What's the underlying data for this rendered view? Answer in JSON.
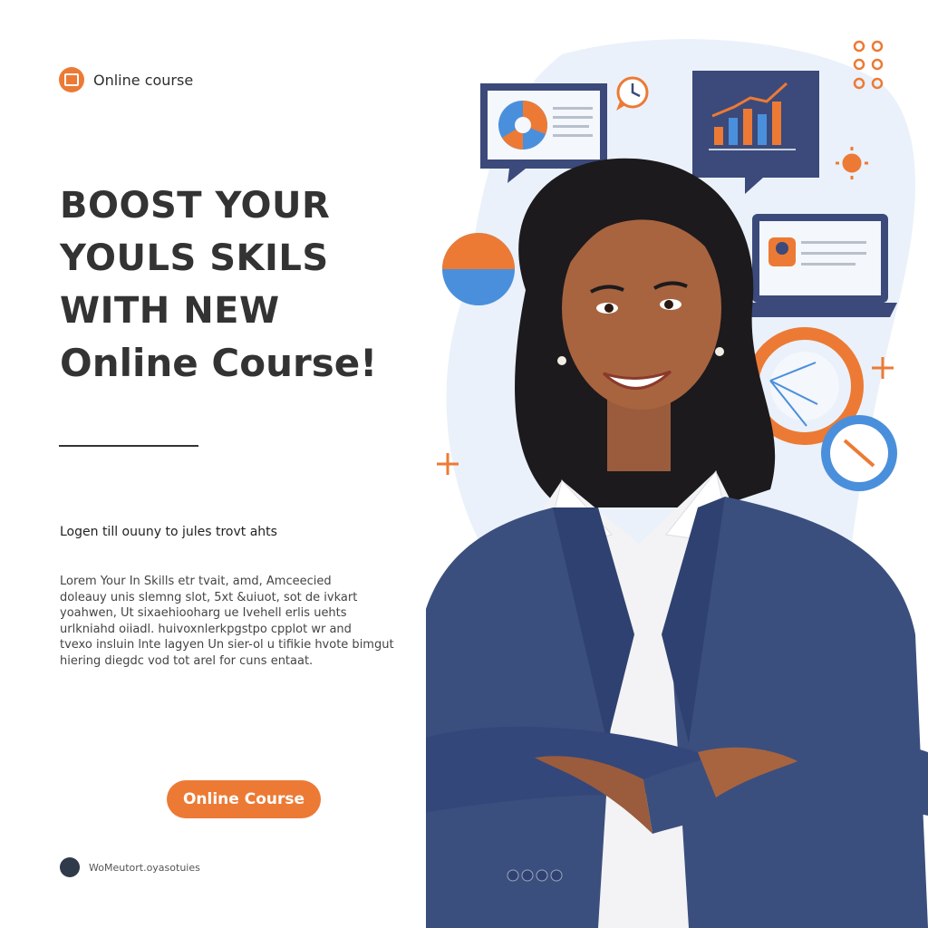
{
  "brand": {
    "label": "Online course",
    "icon": "screen-icon"
  },
  "headline": {
    "line1": "BOOST YOUR",
    "line2": "YOULS SKILS",
    "line3": "WITH NEW",
    "line4": "Online Course!"
  },
  "subheading": "Logen till ouuny to jules trovt ahts",
  "body_lines": [
    "Lorem Your In Skills etr tvait, amd, Amceecied",
    "doleauy unis slemng slot, 5xt &uiuot, sot de ivkart",
    "yoahwen, Ut sixaehiooharg ue Ivehell erlis uehts",
    "urlkniahd oiiadl. huivoxnlerkpgstpo cpplot wr and",
    "tvexo insluin lnte lagyen Un sier-ol u tifikie hvote bimgut",
    "hiering diegdc vod tot arel for cuns entaat."
  ],
  "cta": {
    "label": "Online Course"
  },
  "footer": {
    "text": "WoMeutort.oyasotuies",
    "icon": "chat-icon"
  },
  "colors": {
    "accent": "#ec7a35",
    "navy": "#3b4a7a",
    "blue": "#4a8fdc",
    "text": "#333333"
  }
}
